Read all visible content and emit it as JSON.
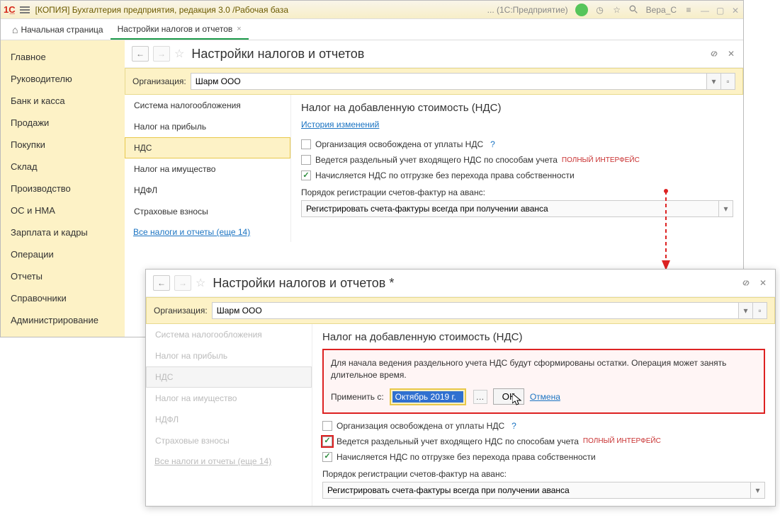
{
  "titlebar": {
    "app_title": "[КОПИЯ] Бухгалтерия предприятия, редакция 3.0 /Рабочая база",
    "suffix": "... (1С:Предприятие)",
    "user": "Вера_С"
  },
  "tabs": {
    "home": "Начальная страница",
    "active": "Настройки налогов и отчетов"
  },
  "sidebar": {
    "items": [
      "Главное",
      "Руководителю",
      "Банк и касса",
      "Продажи",
      "Покупки",
      "Склад",
      "Производство",
      "ОС и НМА",
      "Зарплата и кадры",
      "Операции",
      "Отчеты",
      "Справочники",
      "Администрирование"
    ]
  },
  "panel1": {
    "title": "Настройки налогов и отчетов",
    "org_label": "Организация:",
    "org_value": "Шарм ООО",
    "nav_items": [
      "Система налогообложения",
      "Налог на прибыль",
      "НДС",
      "Налог на имущество",
      "НДФЛ",
      "Страховые взносы"
    ],
    "nav_link": "Все налоги и отчеты (еще 14)",
    "heading": "Налог на добавленную стоимость (НДС)",
    "history_link": "История изменений",
    "checkboxes": {
      "cb1": "Организация освобождена от уплаты НДС",
      "cb2": "Ведется раздельный учет входящего НДС по способам учета",
      "cb3": "Начисляется НДС по отгрузке без перехода права собственности"
    },
    "badge": "ПОЛНЫЙ ИНТЕРФЕЙС",
    "invoice_label": "Порядок регистрации счетов-фактур на аванс:",
    "invoice_value": "Регистрировать счета-фактуры всегда при получении аванса"
  },
  "panel2": {
    "title": "Настройки налогов и отчетов *",
    "org_label": "Организация:",
    "org_value": "Шарм ООО",
    "nav_items": [
      "Система налогообложения",
      "Налог на прибыль",
      "НДС",
      "Налог на имущество",
      "НДФЛ",
      "Страховые взносы"
    ],
    "nav_link": "Все налоги и отчеты (еще 14)",
    "heading": "Налог на добавленную стоимость (НДС)",
    "dialog_text": "Для начала ведения раздельного учета НДС будут сформированы остатки. Операция может занять длительное время.",
    "apply_label": "Применить с:",
    "apply_value": "Октябрь 2019 г.",
    "ok_label": "ОК",
    "cancel_label": "Отмена",
    "checkboxes": {
      "cb1": "Организация освобождена от уплаты НДС",
      "cb2": "Ведется раздельный учет входящего НДС по способам учета",
      "cb3": "Начисляется НДС по отгрузке без перехода права собственности"
    },
    "badge": "ПОЛНЫЙ ИНТЕРФЕЙС",
    "invoice_label": "Порядок регистрации счетов-фактур на аванс:",
    "invoice_value": "Регистрировать счета-фактуры всегда при получении аванса"
  }
}
